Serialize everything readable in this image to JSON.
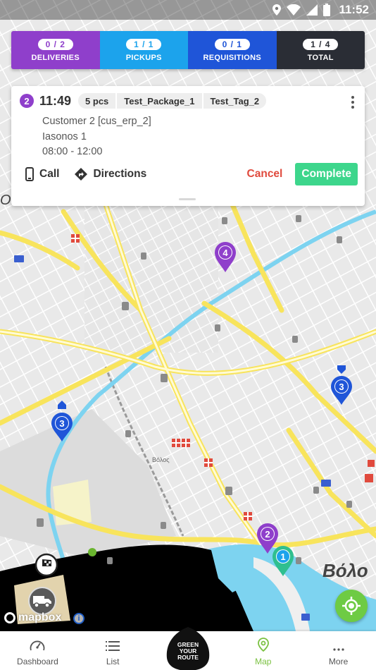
{
  "status_bar": {
    "time": "11:52"
  },
  "stats": [
    {
      "count": "0 / 2",
      "label": "DELIVERIES"
    },
    {
      "count": "1 / 1",
      "label": "PICKUPS"
    },
    {
      "count": "0 / 1",
      "label": "REQUISITIONS"
    },
    {
      "count": "1 / 4",
      "label": "TOTAL"
    }
  ],
  "stop_card": {
    "stop_number": "2",
    "time": "11:49",
    "chips": [
      "5 pcs",
      "Test_Package_1",
      "Test_Tag_2"
    ],
    "customer": "Customer 2 [cus_erp_2]",
    "address": "Iasonos 1",
    "time_window": "08:00 - 12:00",
    "call_label": "Call",
    "directions_label": "Directions",
    "cancel_label": "Cancel",
    "complete_label": "Complete"
  },
  "map": {
    "city_label_small": "Βόλος",
    "city_label_large": "Βόλο",
    "edge_label": "Οι",
    "mapbox_label": "mapbox",
    "info_label": "i",
    "markers": [
      {
        "label": "4",
        "color": "#8f3fcb"
      },
      {
        "label": "3",
        "color": "#1f55d8"
      },
      {
        "label": "3",
        "color": "#1f55d8"
      },
      {
        "label": "2",
        "color": "#8f3fcb"
      },
      {
        "label": "1",
        "color": "#1ca3ec"
      }
    ]
  },
  "bottom_nav": {
    "dashboard": "Dashboard",
    "list": "List",
    "map": "Map",
    "more": "More",
    "brand_line1": "GREEN",
    "brand_line2": "YOUR",
    "brand_line3": "ROUTE"
  },
  "colors": {
    "deliveries": "#8f3fcb",
    "pickups": "#1ca3ec",
    "requisitions": "#1f55d8",
    "total": "#2a2d35",
    "cancel": "#e04a3d",
    "complete": "#3dd68c",
    "active_nav": "#7bc142",
    "sea": "#7dd3f0",
    "road_major": "#f8e45c"
  }
}
